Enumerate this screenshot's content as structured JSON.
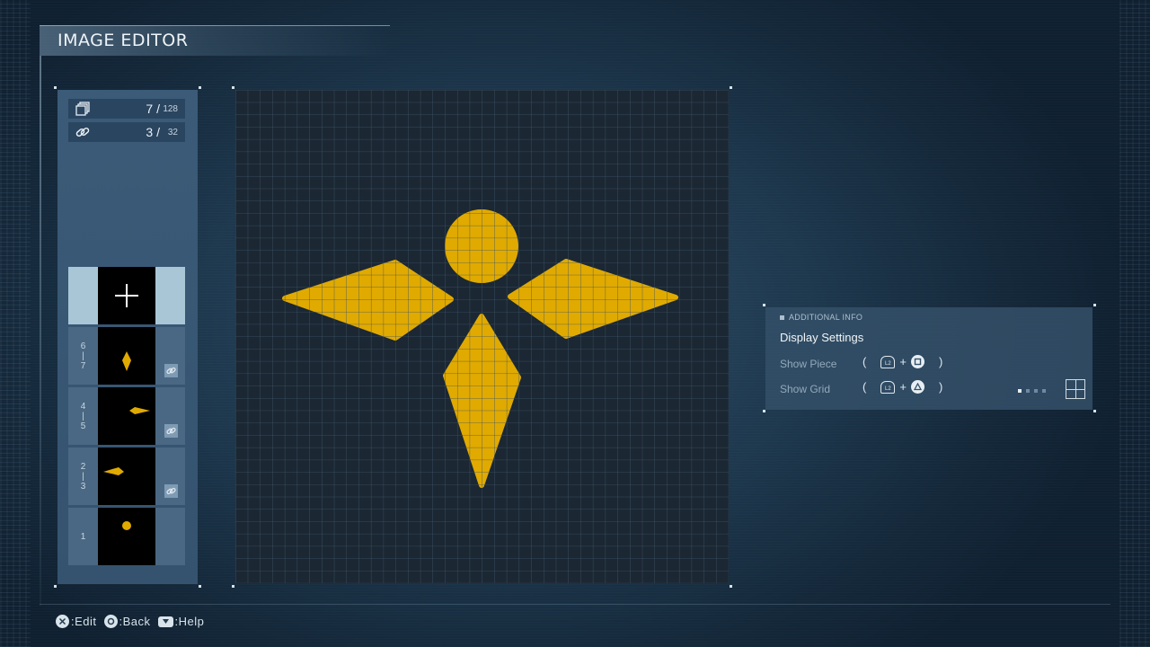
{
  "app": {
    "title": "IMAGE EDITOR"
  },
  "counters": {
    "pieces": {
      "icon": "layers-icon",
      "current": "7 /",
      "max": "128"
    },
    "links": {
      "icon": "link-icon",
      "current": "3 /",
      "max": "32"
    }
  },
  "layers": {
    "add_slot": {
      "icon": "plus-icon"
    },
    "items": [
      {
        "label_top": "6",
        "label_bottom": "7",
        "linked": true,
        "shape": "diamond-vertical"
      },
      {
        "label_top": "4",
        "label_bottom": "5",
        "linked": true,
        "shape": "diamond-right"
      },
      {
        "label_top": "2",
        "label_bottom": "3",
        "linked": true,
        "shape": "diamond-left"
      },
      {
        "label_top": "1",
        "label_bottom": "",
        "linked": false,
        "shape": "circle"
      }
    ]
  },
  "canvas": {
    "emblem_color": "#e0aa00",
    "grid_color": "#3f5466",
    "background": "#1b2733"
  },
  "info_panel": {
    "header": "ADDITIONAL INFO",
    "title": "Display Settings",
    "rows": [
      {
        "label": "Show Piece",
        "modifier": "L2",
        "button": "square-button-icon"
      },
      {
        "label": "Show Grid",
        "modifier": "L2",
        "button": "triangle-button-icon"
      }
    ],
    "grid_level_active": 1,
    "grid_level_total": 4
  },
  "footer": {
    "hints": [
      {
        "button": "cross-button-icon",
        "text": ":Edit"
      },
      {
        "button": "circle-button-icon",
        "text": ":Back"
      },
      {
        "button": "touchpad-button-icon",
        "text": ":Help"
      }
    ]
  },
  "colors": {
    "accent": "#e0aa00",
    "panel": "#3b5b78",
    "add_slot": "#a9c6d6"
  }
}
